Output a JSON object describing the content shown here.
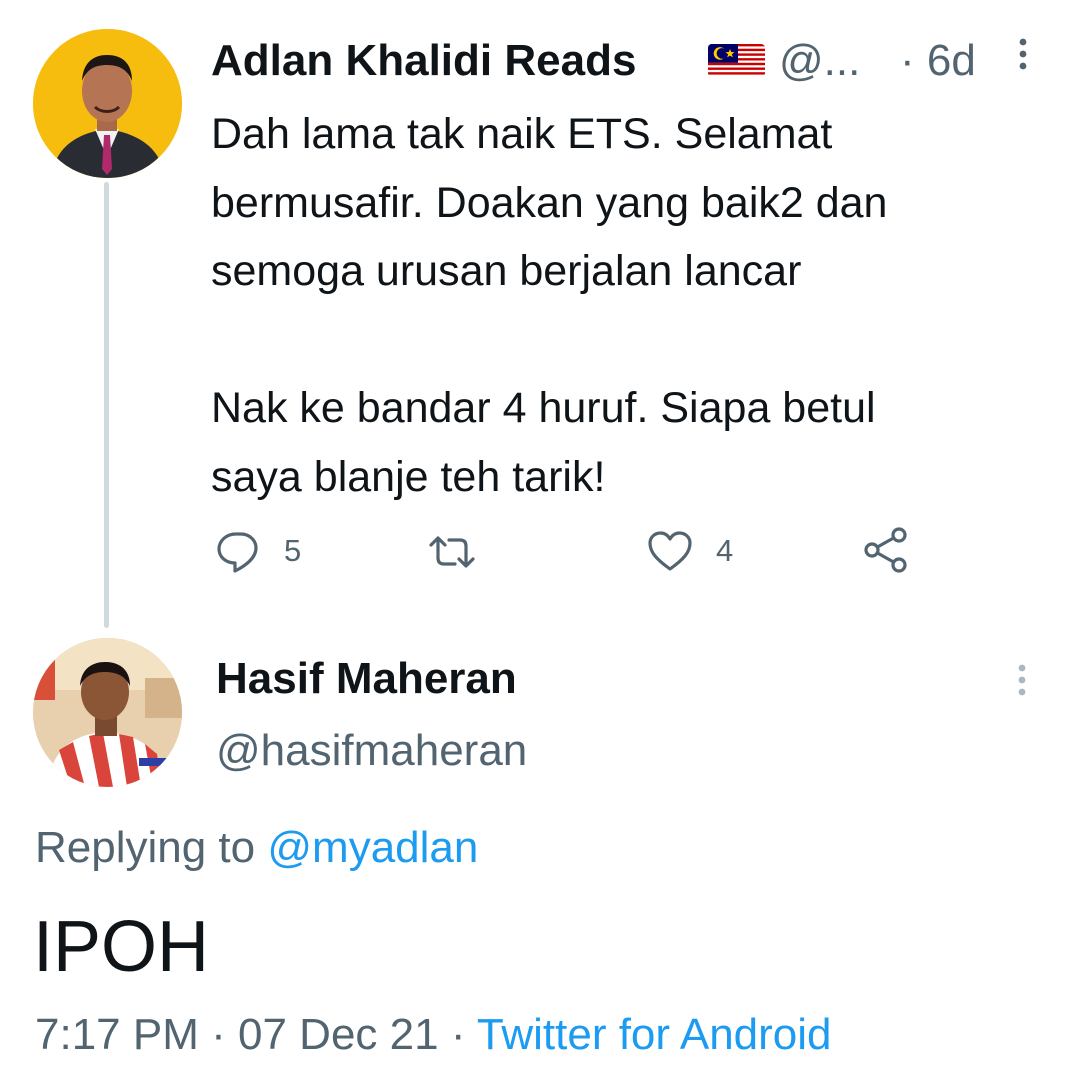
{
  "parent_tweet": {
    "author_name": "Adlan Khalidi Reads",
    "author_flag": "malaysia-flag-emoji",
    "handle": "@...",
    "separator": "·",
    "time": "6d",
    "text_lines": [
      "Dah lama tak naik ETS. Selamat",
      "bermusafir. Doakan yang baik2 dan",
      "semoga urusan berjalan lancar",
      "Nak ke bandar 4 huruf. Siapa betul",
      "saya blanje teh tarik!"
    ],
    "actions": {
      "reply_count": "5",
      "retweet_count": "",
      "like_count": "4"
    },
    "avatar_bg": "#f6bd0f"
  },
  "reply_tweet": {
    "author_name": "Hasif Maheran",
    "handle": "@hasifmaheran",
    "replying_label": "Replying to",
    "replying_mention": "@myadlan",
    "text": "IPOH",
    "time": "7:17 PM",
    "date": "07 Dec 21",
    "meta_separator": "·",
    "source": "Twitter for Android"
  },
  "colors": {
    "accent": "#1d9bf0",
    "text_primary": "#0f1419",
    "text_secondary": "#536471",
    "thread_line": "#cfd9de"
  }
}
